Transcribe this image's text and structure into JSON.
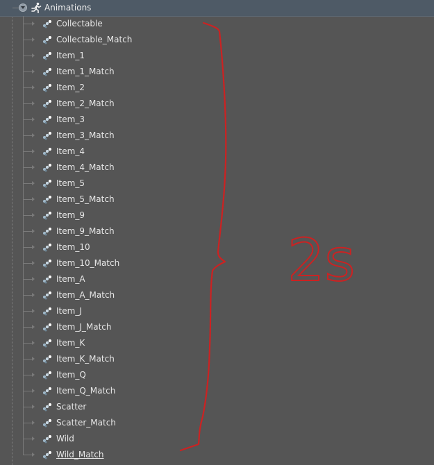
{
  "tree": {
    "root": {
      "label": "Animations",
      "icon": "running-figure-icon"
    },
    "items": [
      {
        "label": "Collectable"
      },
      {
        "label": "Collectable_Match"
      },
      {
        "label": "Item_1"
      },
      {
        "label": "Item_1_Match"
      },
      {
        "label": "Item_2"
      },
      {
        "label": "Item_2_Match"
      },
      {
        "label": "Item_3"
      },
      {
        "label": "Item_3_Match"
      },
      {
        "label": "Item_4"
      },
      {
        "label": "Item_4_Match"
      },
      {
        "label": "Item_5"
      },
      {
        "label": "Item_5_Match"
      },
      {
        "label": "Item_9"
      },
      {
        "label": "Item_9_Match"
      },
      {
        "label": "Item_10"
      },
      {
        "label": "Item_10_Match"
      },
      {
        "label": "Item_A"
      },
      {
        "label": "Item_A_Match"
      },
      {
        "label": "Item_J"
      },
      {
        "label": "Item_J_Match"
      },
      {
        "label": "Item_K"
      },
      {
        "label": "Item_K_Match"
      },
      {
        "label": "Item_Q"
      },
      {
        "label": "Item_Q_Match"
      },
      {
        "label": "Scatter"
      },
      {
        "label": "Scatter_Match"
      },
      {
        "label": "Wild"
      },
      {
        "label": "Wild_Match"
      }
    ],
    "item_icon": "animation-sequence-icon"
  },
  "annotation": {
    "text": "2s",
    "color": "#cc2222"
  },
  "colors": {
    "background": "#555555",
    "header_background": "#4e5a66",
    "text": "#e6e6e6"
  }
}
